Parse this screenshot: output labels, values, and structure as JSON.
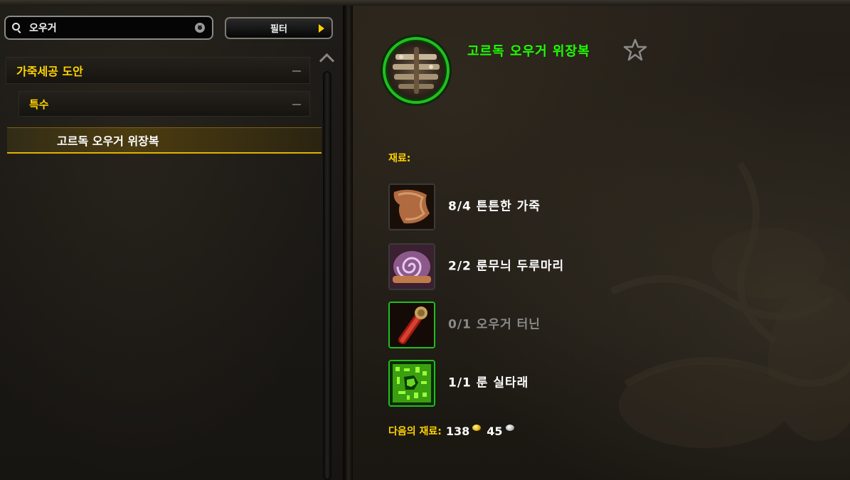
{
  "search": {
    "value": "오우거",
    "placeholder": "",
    "icon": "search-icon",
    "clear_icon": "clear-icon"
  },
  "filter": {
    "label": "필터",
    "icon": "arrow-right-icon",
    "icon_color": "#ffd200"
  },
  "recipe_list": {
    "category": "가죽세공 도안",
    "subcategory": "특수",
    "items": [
      {
        "label": "고르독 오우거 위장복",
        "selected": true
      }
    ]
  },
  "details": {
    "item_name": "고르독 오우거 위장복",
    "item_quality_color": "#1eff00",
    "favorite_icon": "star-outline-icon",
    "reagents_label": "재료:",
    "reagents": [
      {
        "count": "8/4",
        "name": "튼튼한 가죽",
        "icon": "leather-icon",
        "has_enough": true
      },
      {
        "count": "2/2",
        "name": "룬무늬 두루마리",
        "icon": "rune-scroll-icon",
        "has_enough": true
      },
      {
        "count": "0/1",
        "name": "오우거 터닌",
        "icon": "ogre-tannin-icon",
        "has_enough": false
      },
      {
        "count": "1/1",
        "name": "룬 실타래",
        "icon": "rune-thread-icon",
        "has_enough": true
      }
    ],
    "cost_label": "다음의 재료:",
    "cost_gold": "138",
    "cost_silver": "45"
  },
  "colors": {
    "header_yellow": "#ffd200",
    "uncommon_green": "#1eff00"
  }
}
